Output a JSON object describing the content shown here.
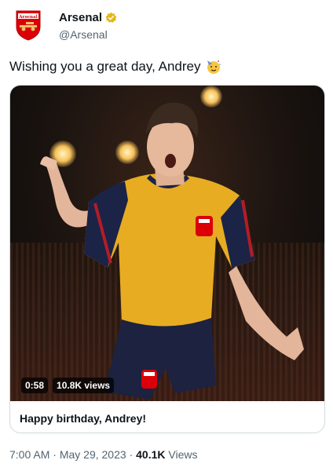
{
  "account": {
    "name": "Arsenal",
    "handle": "@Arsenal",
    "avatar_icon": "arsenal-crest-icon",
    "verified_icon": "verified-gold-badge-icon",
    "avatar_text": "Arsenal"
  },
  "tweet": {
    "text": "Wishing you a great day, Andrey",
    "emoji_icon": "partying-face-emoji-icon"
  },
  "media": {
    "duration": "0:58",
    "views": "10.8K views"
  },
  "card": {
    "title": "Happy birthday, Andrey!"
  },
  "meta": {
    "time": "7:00 AM",
    "sep1": "·",
    "date": "May 29, 2023",
    "sep2": "·",
    "views_count": "40.1K",
    "views_label": "Views"
  },
  "colors": {
    "brand_red": "#db0007",
    "verified_gold": "#e2b719",
    "text_secondary": "#536471",
    "border": "#cfd9de"
  }
}
